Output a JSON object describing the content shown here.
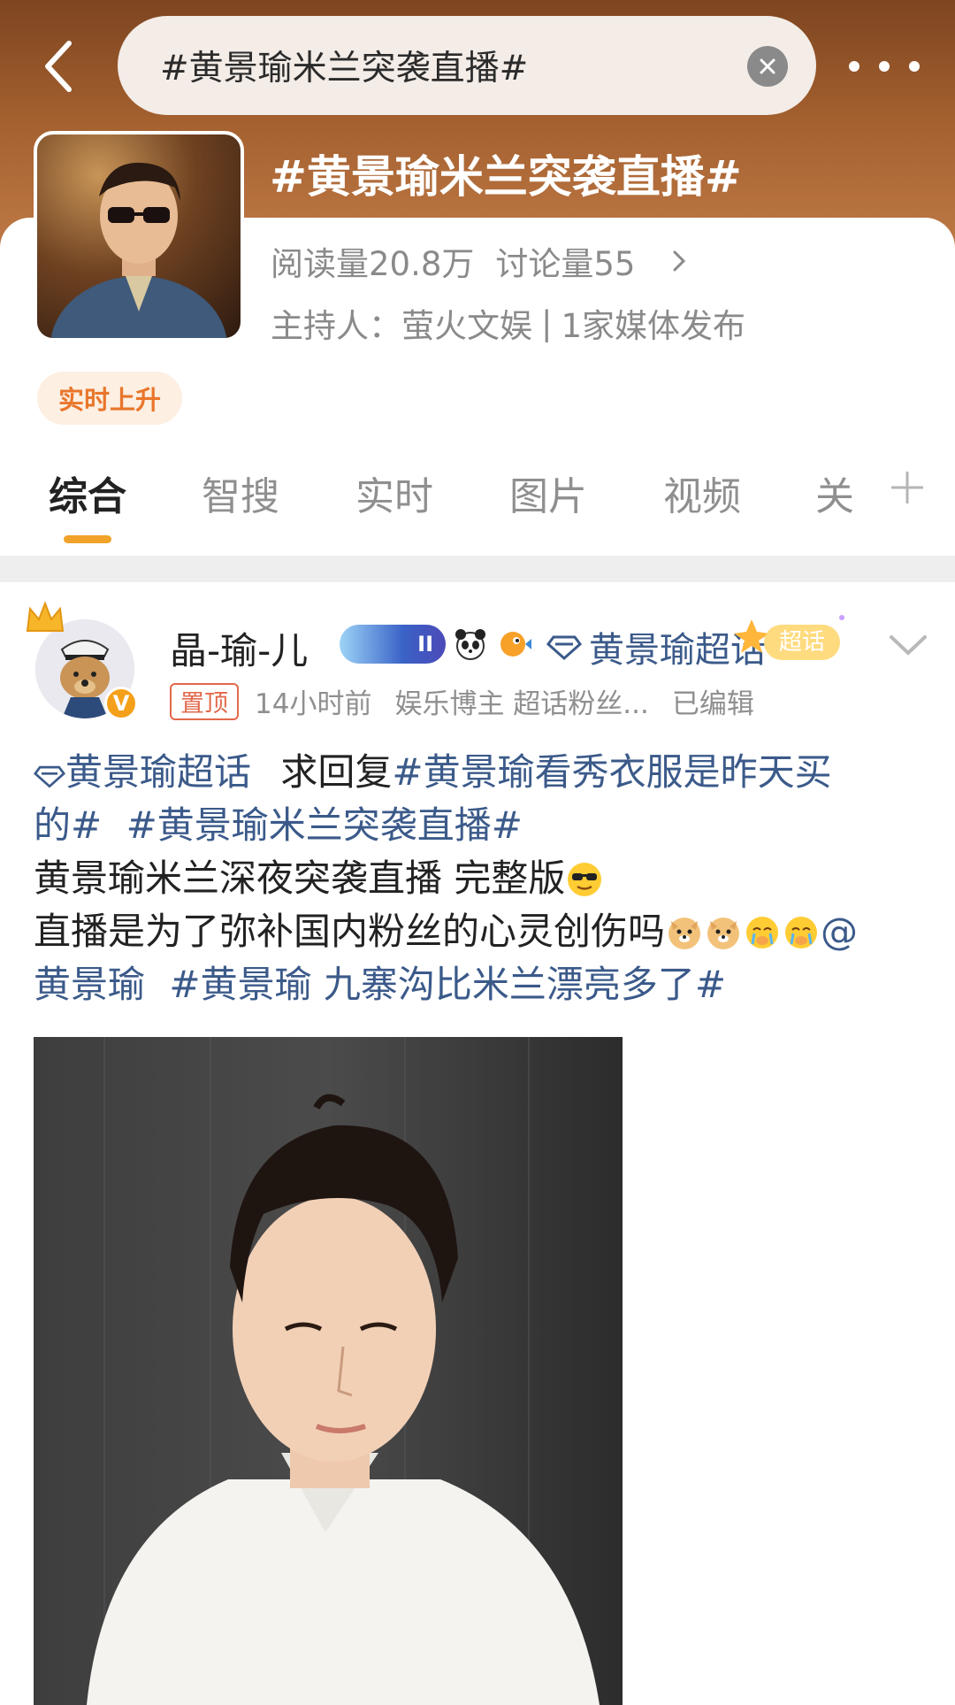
{
  "header": {
    "search_query": "#黄景瑜米兰突袭直播#",
    "topic_title": "#黄景瑜米兰突袭直播#"
  },
  "topic_info": {
    "read_count": "阅读量20.8万",
    "discussion_count": "讨论量55",
    "host_label": "主持人：",
    "host_name": "萤火文娱",
    "separator": "|",
    "media_count": "1家媒体发布",
    "rising_badge": "实时上升"
  },
  "tabs": [
    "综合",
    "智搜",
    "实时",
    "图片",
    "视频",
    "关"
  ],
  "post": {
    "username": "晶-瑜-儿",
    "vip_level": "II",
    "chaohua_link": "黄景瑜超话",
    "chaohua_sticker": "超话",
    "pinned_label": "置顶",
    "time": "14小时前",
    "user_desc": "娱乐博主 超话粉丝...",
    "edited": "已编辑",
    "body": {
      "line1_link": "黄景瑜超话",
      "line1_text": "求回复",
      "line1_topic": "#黄景瑜看秀衣服是昨天买",
      "line2_topic_end": "的#",
      "line2_topic2": "#黄景瑜米兰突袭直播#",
      "line3_text": "黄景瑜米兰深夜突袭直播 完整版",
      "line4_text": "直播是为了弥补国内粉丝的心灵创伤吗",
      "line4_at": "@",
      "line5_mention": "黄景瑜",
      "line5_topic": "#黄景瑜 九寨沟比米兰漂亮多了#"
    }
  },
  "colors": {
    "header_gradient_top": "#7d4520",
    "link": "#3b5a8a",
    "tab_underline": "#f1a22a",
    "rising_text": "#e9762b",
    "pinned": "#e2694b"
  }
}
